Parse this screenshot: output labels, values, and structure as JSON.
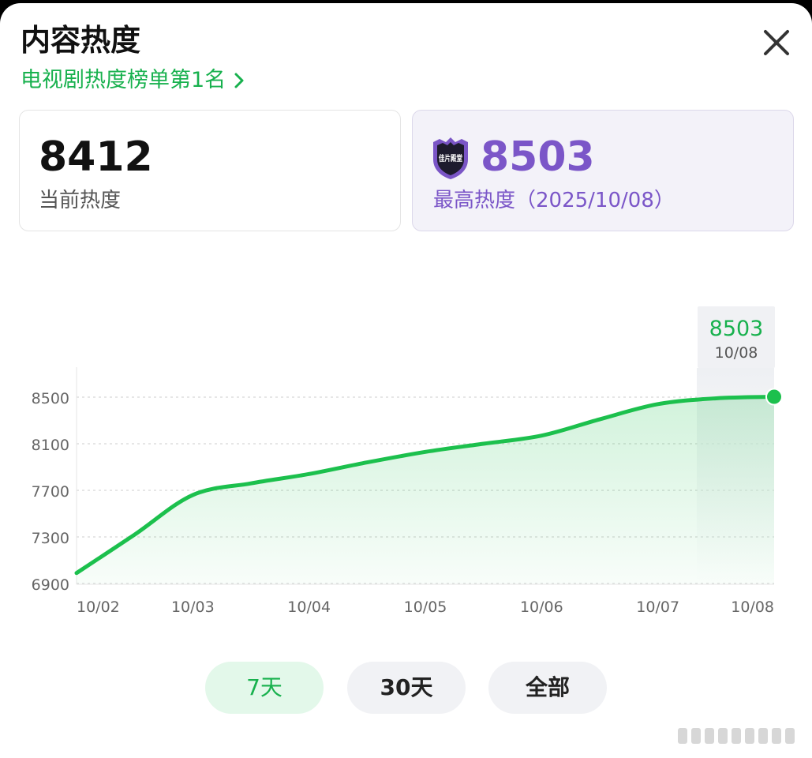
{
  "header": {
    "title": "内容热度",
    "rank_link": "电视剧热度榜单第1名"
  },
  "current": {
    "value": "8412",
    "label": "当前热度"
  },
  "max": {
    "value": "8503",
    "label": "最高热度（2025/10/08）",
    "badge_text": "佳片殿堂"
  },
  "tabs": {
    "t7": "7天",
    "t30": "30天",
    "all": "全部"
  },
  "chart_data": {
    "type": "area",
    "x": [
      "10/02",
      "10/03",
      "10/04",
      "10/05",
      "10/06",
      "10/07",
      "10/08"
    ],
    "points": [
      {
        "x": "10/02",
        "y": 6990
      },
      {
        "x": "10/02.5",
        "y": 7320
      },
      {
        "x": "10/03",
        "y": 7660
      },
      {
        "x": "10/03.5",
        "y": 7760
      },
      {
        "x": "10/04",
        "y": 7840
      },
      {
        "x": "10/04.5",
        "y": 7940
      },
      {
        "x": "10/05",
        "y": 8030
      },
      {
        "x": "10/05.5",
        "y": 8100
      },
      {
        "x": "10/06",
        "y": 8170
      },
      {
        "x": "10/06.5",
        "y": 8310
      },
      {
        "x": "10/07",
        "y": 8440
      },
      {
        "x": "10/07.5",
        "y": 8490
      },
      {
        "x": "10/08",
        "y": 8503
      }
    ],
    "y_ticks": [
      8500,
      8100,
      7700,
      7300,
      6900
    ],
    "ylim": [
      6900,
      8600
    ],
    "grid": true,
    "line_color": "#1cc04d",
    "fill_color": "#1cc04d",
    "tooltip": {
      "value": "8503",
      "date": "10/08"
    }
  }
}
